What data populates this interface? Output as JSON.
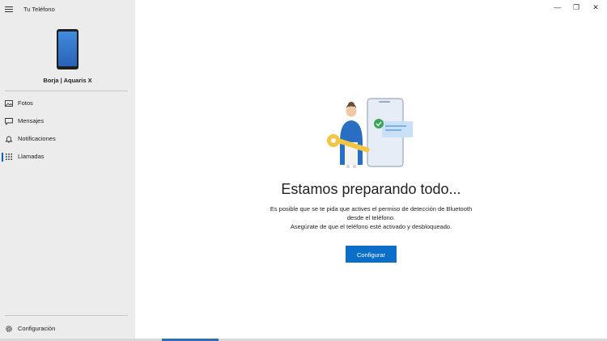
{
  "app": {
    "title": "Tu Teléfono"
  },
  "device": {
    "name": "Borja | Aquaris X"
  },
  "nav": {
    "items": [
      {
        "label": "Fotos",
        "icon": "photo-icon"
      },
      {
        "label": "Mensajes",
        "icon": "message-icon"
      },
      {
        "label": "Notificaciones",
        "icon": "bell-icon"
      },
      {
        "label": "Llamadas",
        "icon": "dialpad-icon",
        "active": true
      }
    ],
    "settings_label": "Configuración"
  },
  "window": {
    "minimize": "—",
    "restore": "❐",
    "close": "✕"
  },
  "main": {
    "title": "Estamos preparando todo...",
    "line1": "Es posible que se te pida que actives el permiso de detección de Bluetooth",
    "line2": "desde el teléfono.",
    "line3": "Asegúrate de que el teléfono esté activado y desbloqueado.",
    "button_label": "Configurar"
  },
  "colors": {
    "accent": "#0b6fc9",
    "sidebar": "#ececec"
  }
}
